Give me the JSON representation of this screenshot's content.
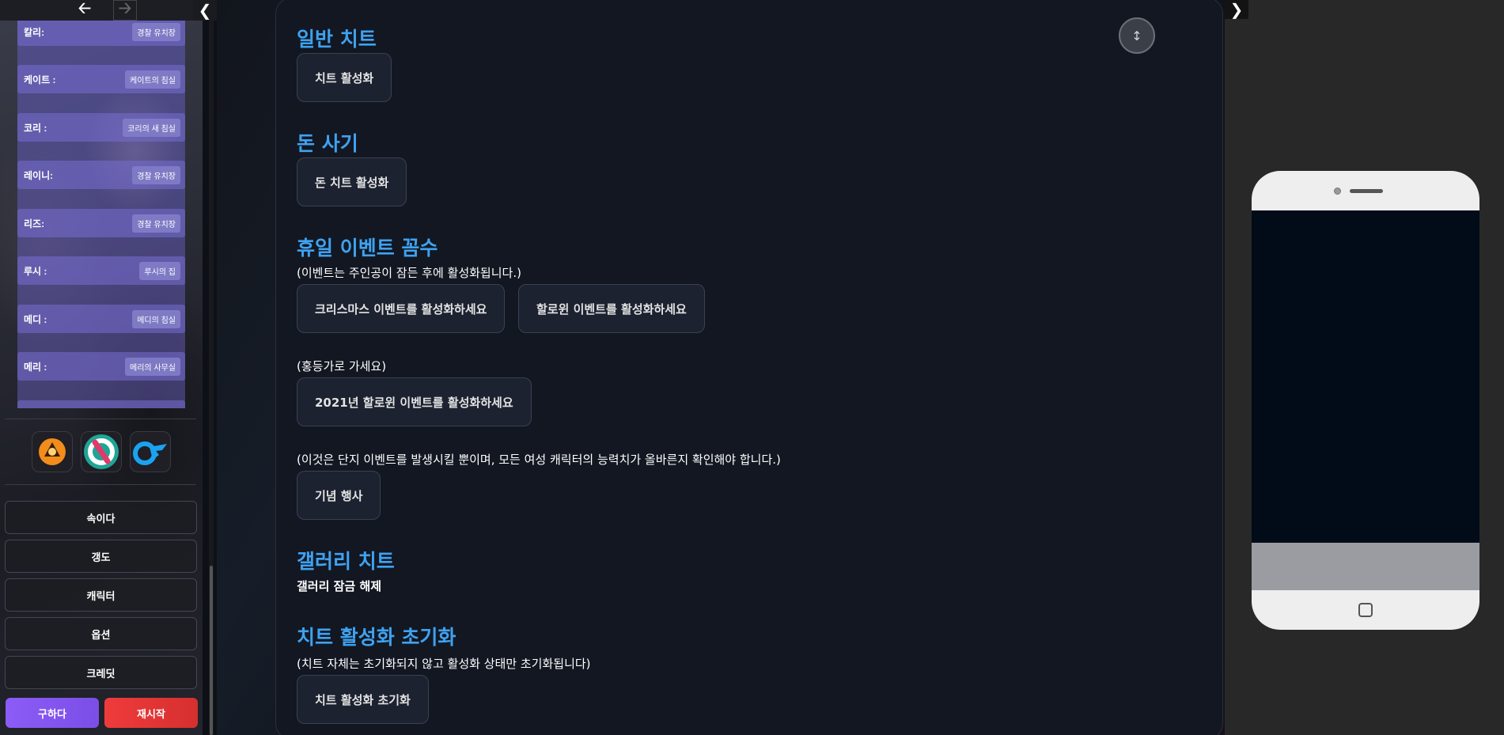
{
  "sidebar": {
    "nav": {
      "back_icon": "arrow-left-icon",
      "forward_icon": "arrow-right-icon",
      "collapse_icon": "chevron-left-icon"
    },
    "characters": [
      {
        "name": "칼리:",
        "location": "경찰 유치장"
      },
      {
        "name": "케이트 :",
        "location": "케이트의 침실"
      },
      {
        "name": "코리 :",
        "location": "코리의 새 침실"
      },
      {
        "name": "레이니:",
        "location": "경찰 유치장"
      },
      {
        "name": "리즈:",
        "location": "경찰 유치장"
      },
      {
        "name": "루시 :",
        "location": "루시의 집"
      },
      {
        "name": "메디 :",
        "location": "메디의 침실"
      },
      {
        "name": "메리 :",
        "location": "메리의 사무실"
      }
    ],
    "social": [
      {
        "name": "studio-logo-icon"
      },
      {
        "name": "subscribestar-icon"
      },
      {
        "name": "onlyfans-icon"
      }
    ],
    "menu": [
      "속이다",
      "갱도",
      "캐릭터",
      "옵션",
      "크레딧"
    ],
    "save_label": "구하다",
    "restart_label": "재시작",
    "colors": {
      "save": "#8b5cf6",
      "restart": "#e53935"
    }
  },
  "main": {
    "general_title": "일반 치트",
    "general_button": "치트 활성화",
    "money_title": "돈 사기",
    "money_button": "돈 치트 활성화",
    "holiday_title": "휴일 이벤트 꼼수",
    "holiday_note": "(이벤트는 주인공이 잠든 후에 활성화됩니다.)",
    "christmas_button": "크리스마스 이벤트를 활성화하세요",
    "halloween_button": "할로윈 이벤트를 활성화하세요",
    "redlight_note": "(홍등가로 가세요)",
    "halloween2021_button": "2021년 할로윈 이벤트를 활성화하세요",
    "stats_note": "(이것은 단지 이벤트를 발생시킬 뿐이며, 모든 여성 캐릭터의 능력치가 올바른지 확인해야 합니다.)",
    "anniversary_button": "기념 행사",
    "gallery_title": "갤러리 치트",
    "gallery_unlock": "갤러리 잠금 해제",
    "reset_title": "치트 활성화 초기화",
    "reset_note": "(치트 자체는 초기화되지 않고 활성화 상태만 초기화됩니다)",
    "reset_button": "치트 활성화 초기화",
    "accent_color": "#3fa2f0"
  },
  "right": {
    "toggle_icon": "chevron-right-icon"
  }
}
